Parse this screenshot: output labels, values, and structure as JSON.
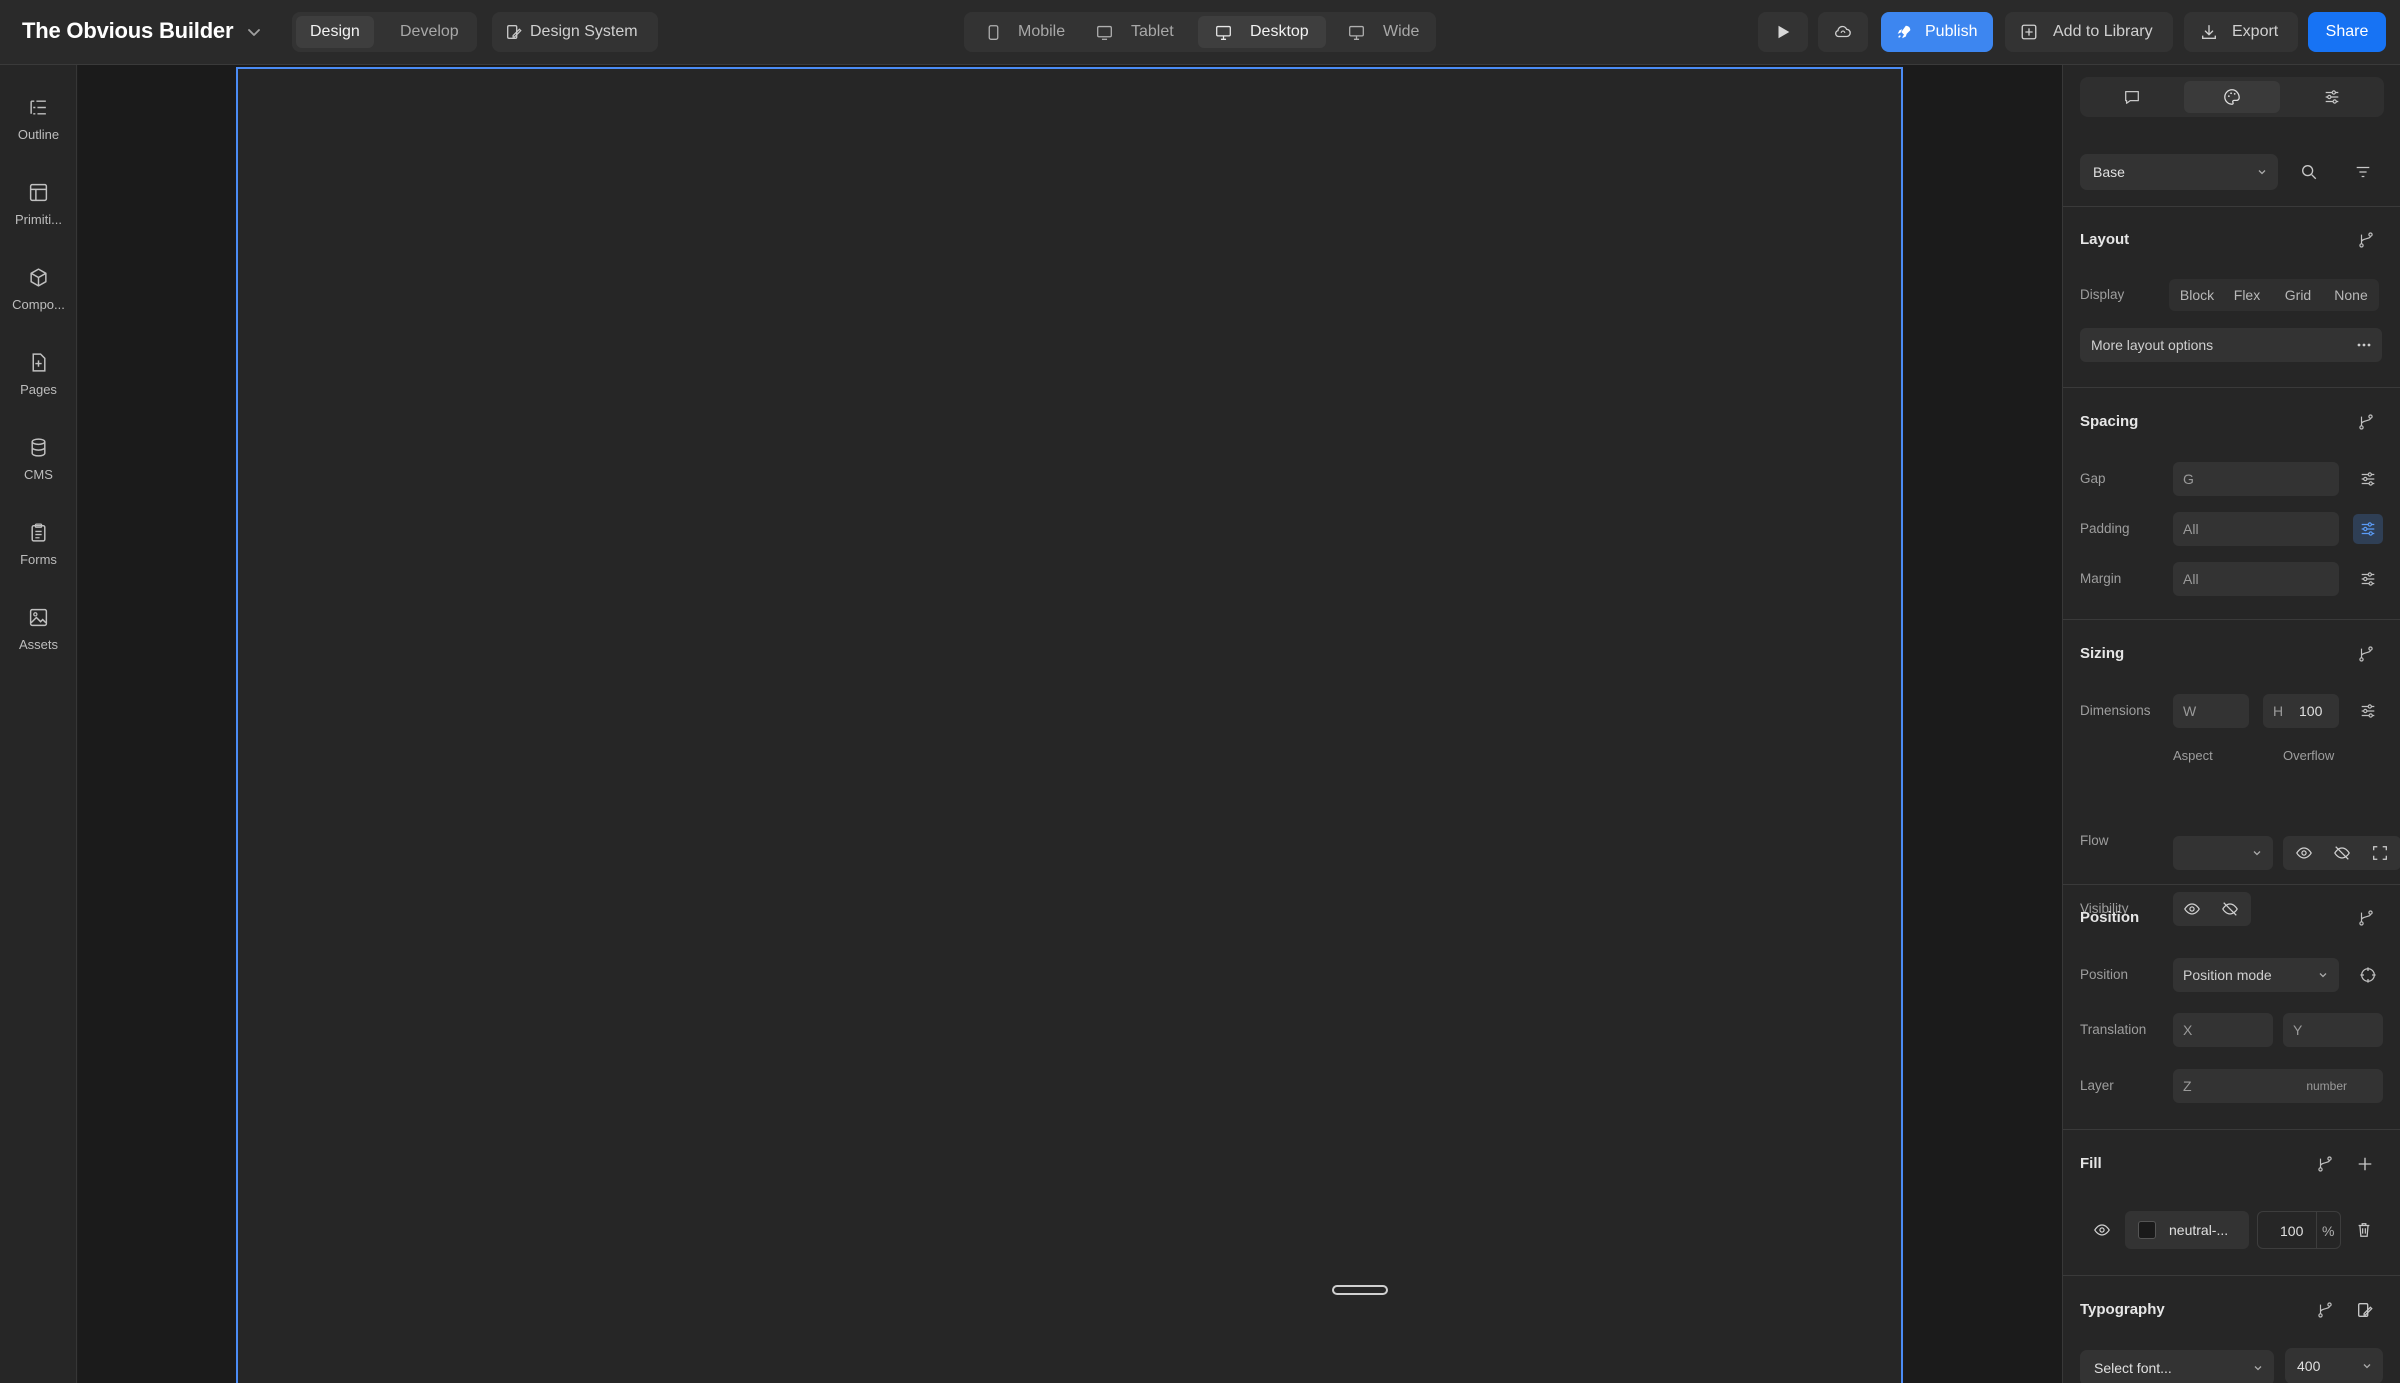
{
  "app": {
    "title": "The Obvious Builder"
  },
  "modes": {
    "design": "Design",
    "develop": "Develop",
    "active": "design"
  },
  "design_system_label": "Design System",
  "breakpoints": [
    {
      "label": "Mobile",
      "icon": "phone-icon"
    },
    {
      "label": "Tablet",
      "icon": "tablet-icon"
    },
    {
      "label": "Desktop",
      "icon": "monitor-icon",
      "active": true
    },
    {
      "label": "Wide",
      "icon": "monitor-icon"
    }
  ],
  "actions": {
    "publish": "Publish",
    "add_to_library": "Add to Library",
    "export": "Export",
    "share": "Share"
  },
  "sidebar": {
    "items": [
      {
        "label": "Outline",
        "icon": "outline-icon"
      },
      {
        "label": "Primiti...",
        "icon": "layout-icon"
      },
      {
        "label": "Compo...",
        "icon": "cube-icon"
      },
      {
        "label": "Pages",
        "icon": "file-plus-icon"
      },
      {
        "label": "CMS",
        "icon": "database-icon"
      },
      {
        "label": "Forms",
        "icon": "clipboard-icon"
      },
      {
        "label": "Assets",
        "icon": "image-icon"
      }
    ]
  },
  "panel": {
    "base_select": "Base",
    "layout": {
      "title": "Layout",
      "display_label": "Display",
      "display_options": [
        "Block",
        "Flex",
        "Grid",
        "None"
      ],
      "more_label": "More layout options"
    },
    "spacing": {
      "title": "Spacing",
      "gap_label": "Gap",
      "gap_value": "G",
      "padding_label": "Padding",
      "padding_value": "All",
      "margin_label": "Margin",
      "margin_value": "All"
    },
    "sizing": {
      "title": "Sizing",
      "dimensions_label": "Dimensions",
      "w_prefix": "W",
      "h_prefix": "H",
      "h_value": "100",
      "flow_label": "Flow",
      "aspect_label": "Aspect",
      "overflow_label": "Overflow",
      "visibility_label": "Visibility"
    },
    "position": {
      "title": "Position",
      "position_label": "Position",
      "position_mode": "Position mode",
      "translation_label": "Translation",
      "x_placeholder": "X",
      "y_placeholder": "Y",
      "layer_label": "Layer",
      "z_placeholder": "Z",
      "z_unit": "number"
    },
    "fill": {
      "title": "Fill",
      "color_name": "neutral-...",
      "opacity": "100",
      "unit": "%"
    },
    "typography": {
      "title": "Typography",
      "font_placeholder": "Select font...",
      "weight": "400"
    }
  },
  "colors": {
    "accent": "#3d86f0",
    "share": "#1773f4",
    "frame_outline": "#4b8cf5",
    "canvas_bg": "#262626"
  }
}
